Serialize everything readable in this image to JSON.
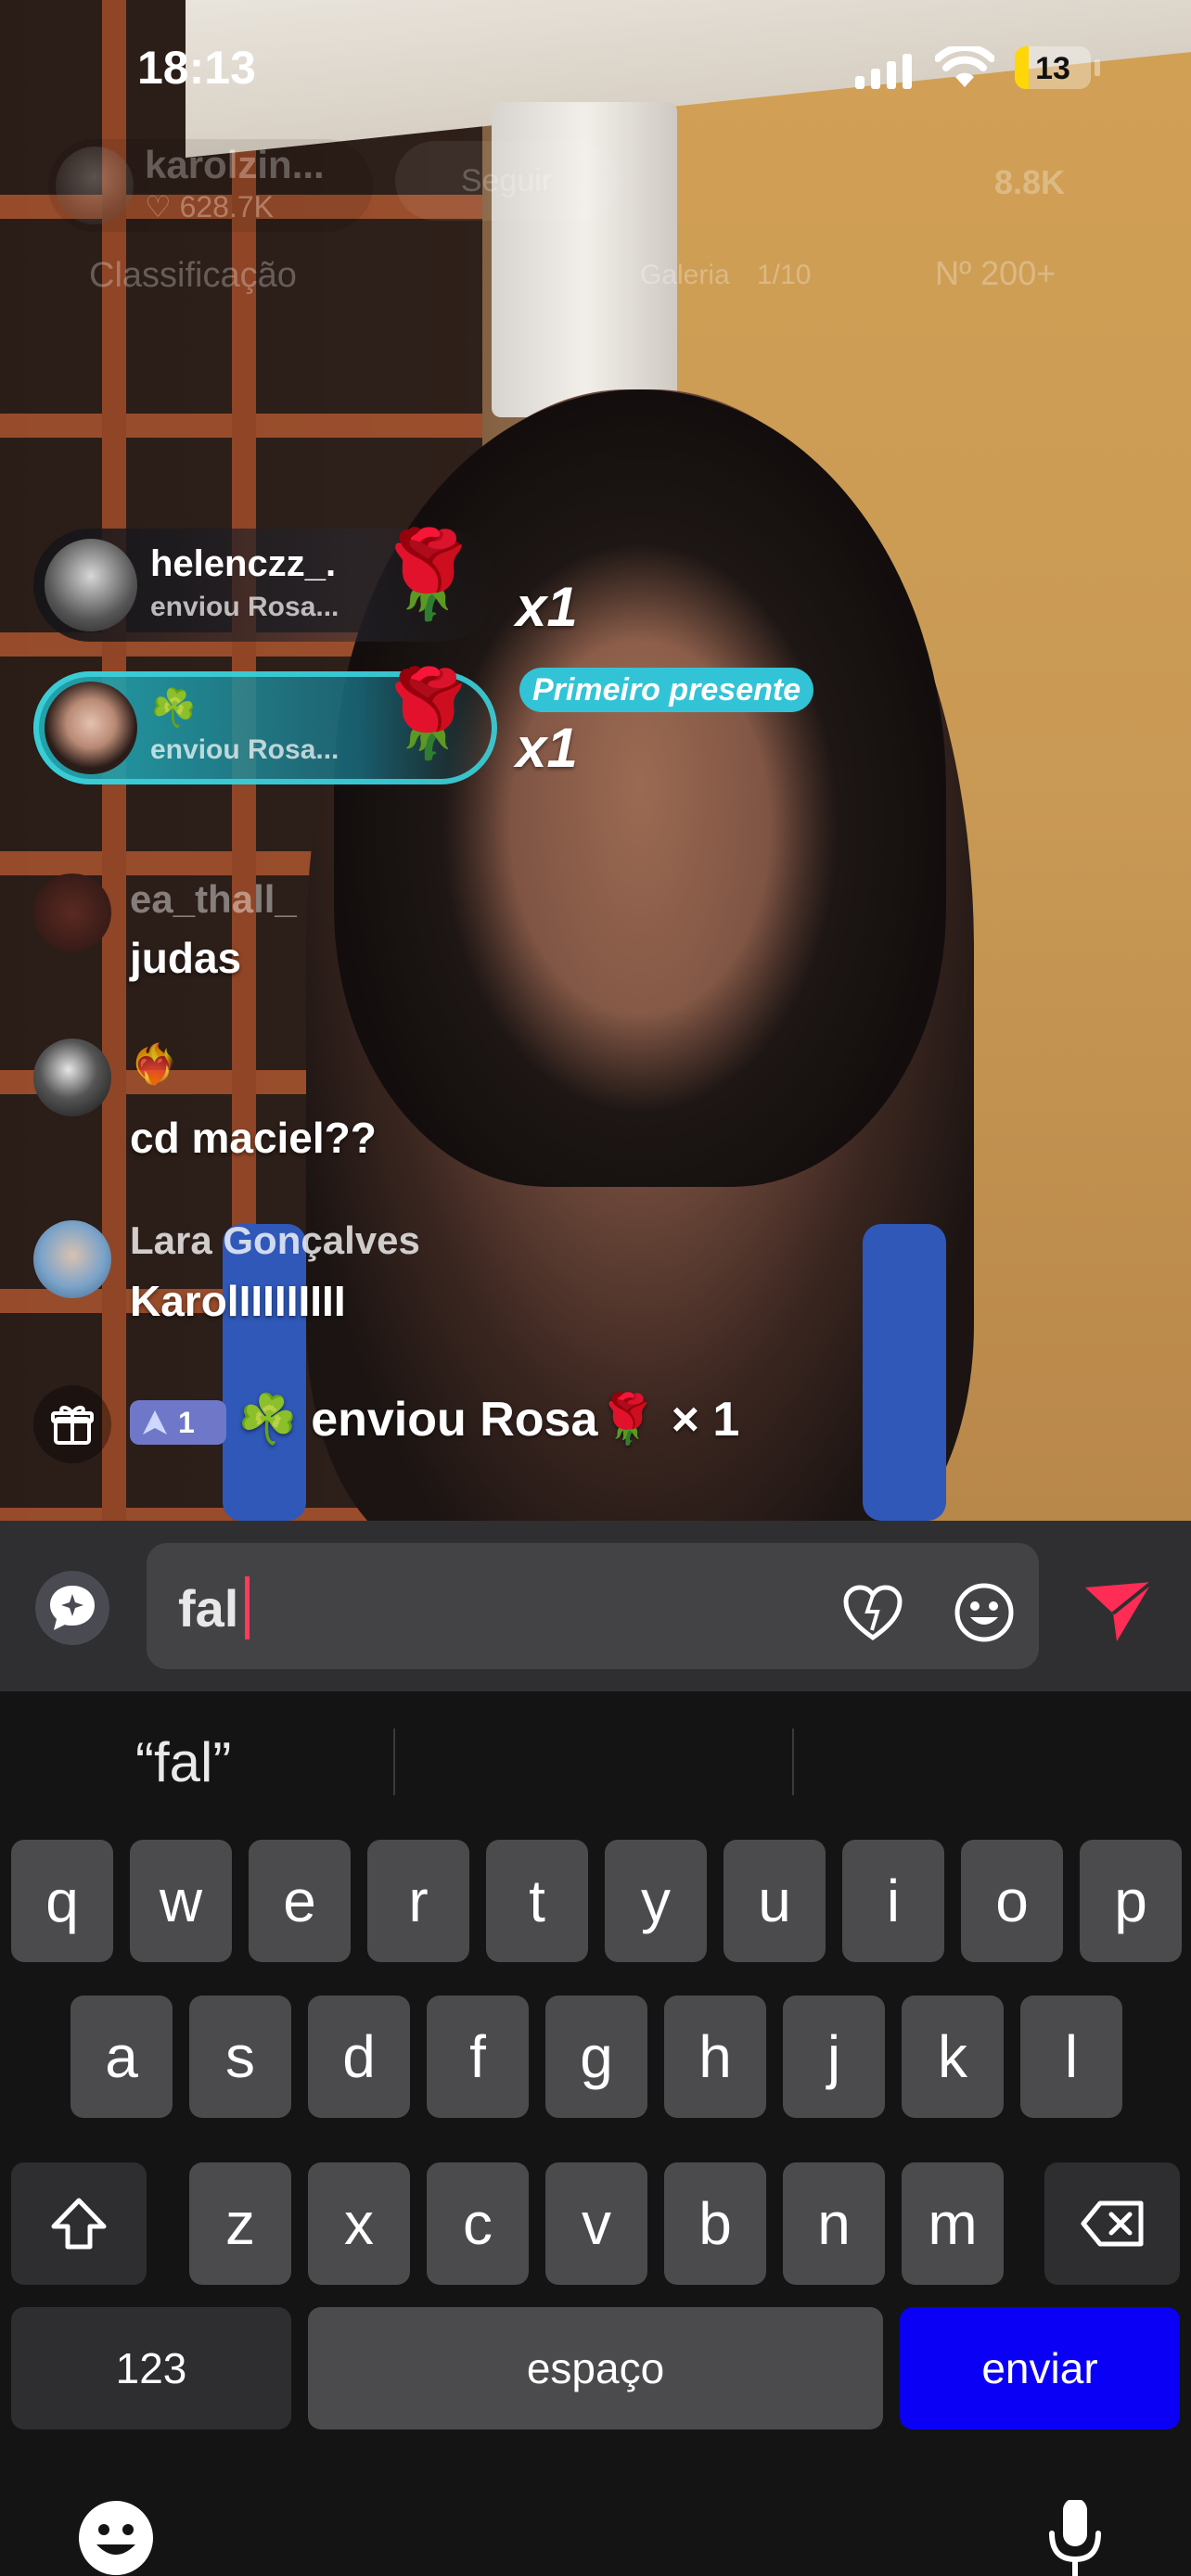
{
  "status_bar": {
    "time": "18:13",
    "battery": "13"
  },
  "live_header": {
    "host_name": "karolzin...",
    "host_likes": "♡ 628.7K",
    "follow_label": "Seguir",
    "viewers": "8.8K",
    "ranking_label": "Classificação",
    "gallery_label": "Galeria",
    "gallery_count": "1/10",
    "rank_number": "Nº 200+"
  },
  "gift_banners": [
    {
      "user": "helenczz_.",
      "subtitle": "enviou Rosa...",
      "gift_icon": "rose-icon",
      "combo": "x1",
      "badge": ""
    },
    {
      "user": "☘️",
      "subtitle": "enviou Rosa...",
      "gift_icon": "rose-icon",
      "combo": "x1",
      "badge": "Primeiro presente"
    }
  ],
  "chat": [
    {
      "user": "ea_thall_",
      "message": "judas"
    },
    {
      "user": "❤️‍🔥",
      "message": "cd maciel??"
    },
    {
      "user": "Lara Gonçalves",
      "message": "KarolIIIIIIIII"
    }
  ],
  "gift_feed": {
    "level": "1",
    "text": "☘️ enviou Rosa🌹 × 1"
  },
  "compose": {
    "value": "fal"
  },
  "keyboard": {
    "suggestion": "“fal”",
    "row1": [
      "q",
      "w",
      "e",
      "r",
      "t",
      "y",
      "u",
      "i",
      "o",
      "p"
    ],
    "row2": [
      "a",
      "s",
      "d",
      "f",
      "g",
      "h",
      "j",
      "k",
      "l"
    ],
    "row3": [
      "z",
      "x",
      "c",
      "v",
      "b",
      "n",
      "m"
    ],
    "numbers_label": "123",
    "space_label": "espaço",
    "return_label": "enviar"
  },
  "colors": {
    "accent_send": "#ff2d55",
    "return_key": "#0a00f5",
    "first_gift_badge": "#33c3d6"
  }
}
